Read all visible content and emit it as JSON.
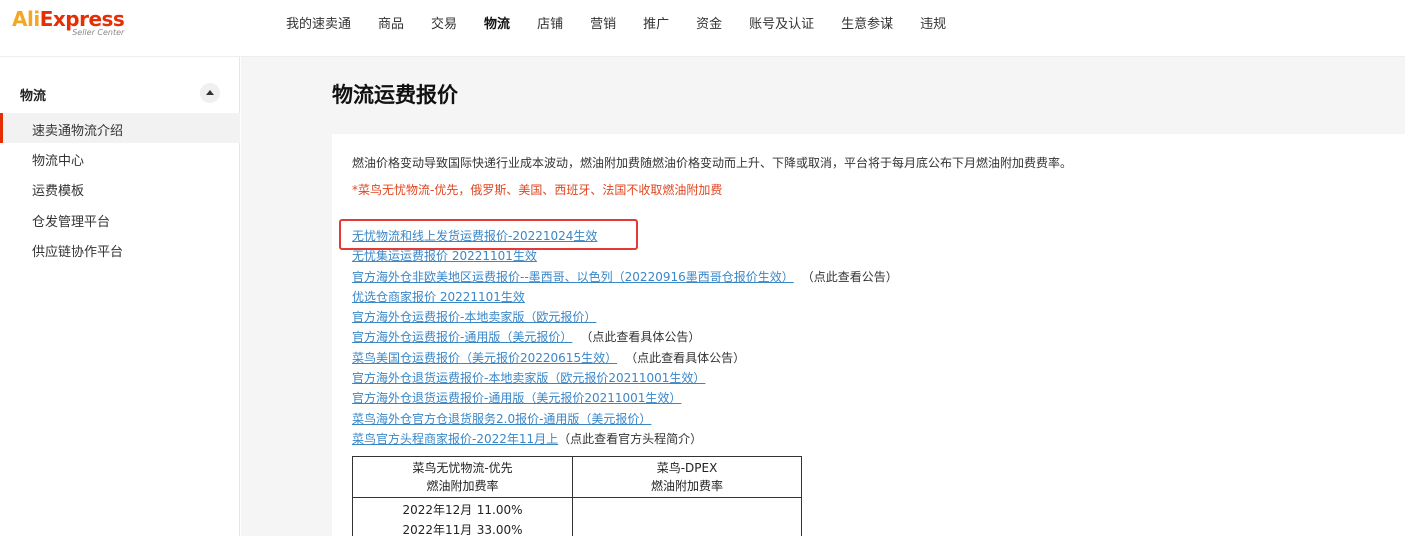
{
  "logo": {
    "text_main_a": "Ali",
    "text_main_b": "Express",
    "text_sub": "Seller Center"
  },
  "nav": {
    "items": [
      "我的速卖通",
      "商品",
      "交易",
      "物流",
      "店铺",
      "营销",
      "推广",
      "资金",
      "账号及认证",
      "生意参谋",
      "违规"
    ],
    "active": "物流"
  },
  "sidebar": {
    "section": "物流",
    "items": [
      "速卖通物流介绍",
      "物流中心",
      "运费模板",
      "仓发管理平台",
      "供应链协作平台"
    ],
    "active_index": 0
  },
  "page": {
    "title": "物流运费报价",
    "notice": "燃油价格变动导致国际快递行业成本波动，燃油附加费随燃油价格变动而上升、下降或取消，平台将于每月底公布下月燃油附加费费率。",
    "warning": "*菜鸟无忧物流-优先，俄罗斯、美国、西班牙、法国不收取燃油附加费"
  },
  "links": [
    {
      "text": "无忧物流和线上发货运费报价-20221024生效",
      "note": ""
    },
    {
      "text": "无忧集运运费报价 20221101生效",
      "note": ""
    },
    {
      "text": "官方海外仓非欧美地区运费报价--墨西哥、以色列（20220916墨西哥仓报价生效）",
      "note": "（点此查看公告）"
    },
    {
      "text": "优选仓商家报价 20221101生效",
      "note": ""
    },
    {
      "text": "官方海外仓运费报价-本地卖家版（欧元报价）",
      "note": ""
    },
    {
      "text": "官方海外仓运费报价-通用版（美元报价）",
      "note": "（点此查看具体公告）"
    },
    {
      "text": "菜鸟美国仓运费报价（美元报价20220615生效）",
      "note": "（点此查看具体公告）"
    },
    {
      "text": "官方海外仓退货运费报价-本地卖家版（欧元报价20211001生效）",
      "note": ""
    },
    {
      "text": "官方海外仓退货运费报价-通用版（美元报价20211001生效）",
      "note": ""
    },
    {
      "text": "菜鸟海外仓官方仓退货服务2.0报价-通用版（美元报价）",
      "note": ""
    },
    {
      "text": "菜鸟官方头程商家报价-2022年11月上",
      "note": "（点此查看官方头程简介）"
    }
  ],
  "table": {
    "col1_title": "菜鸟无忧物流-优先",
    "col1_sub": "燃油附加费率",
    "col2_title": "菜鸟-DPEX",
    "col2_sub": "燃油附加费率",
    "col1_rates": [
      {
        "month": "2022年12月",
        "rate": "11.00%"
      },
      {
        "month": "2022年11月",
        "rate": "33.00%"
      }
    ]
  },
  "colors": {
    "accent": "#e62e04",
    "link": "#3a87c8",
    "warning": "#e0461f",
    "highlight_box": "#e53935"
  }
}
